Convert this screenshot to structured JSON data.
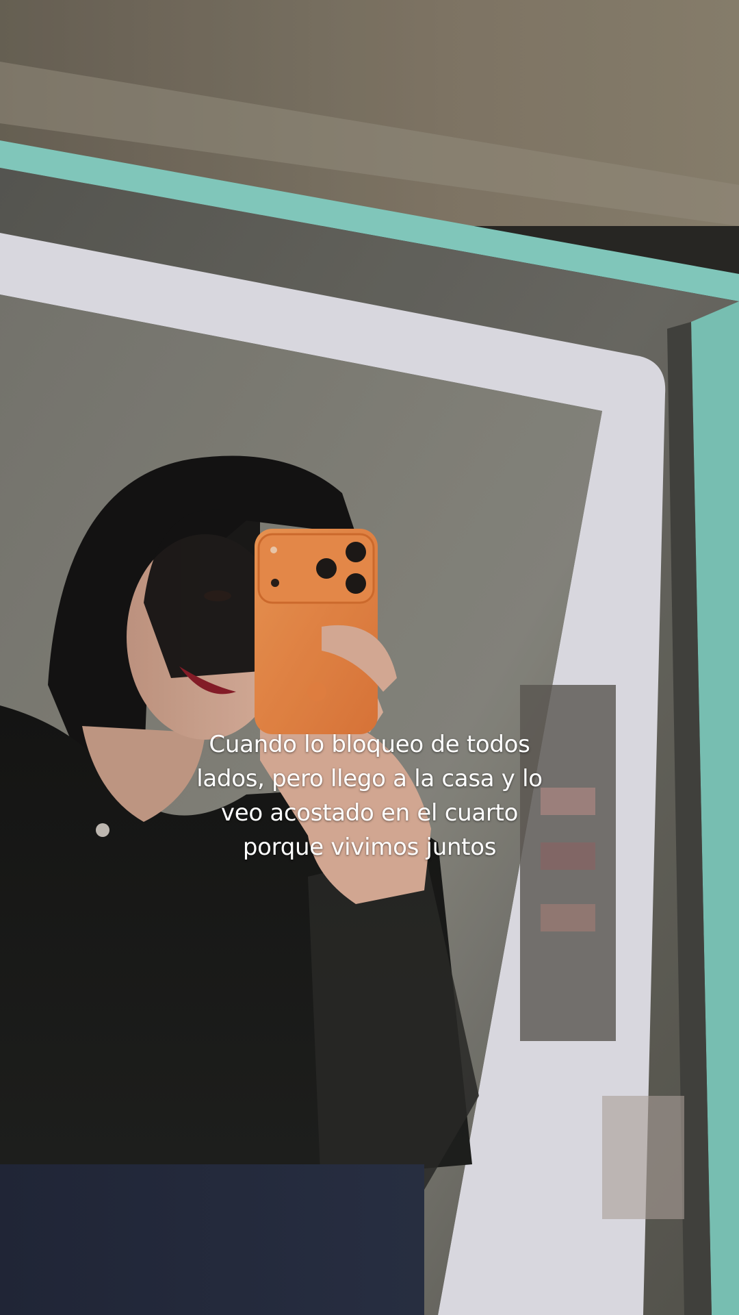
{
  "overlay": {
    "caption": "Cuando lo bloqueo de todos lados, pero llego a la casa y lo veo acostado en el cuarto porque vivimos juntos",
    "caption_color": "#ffffff"
  },
  "photo": {
    "description_icon": "mirror-selfie-photo",
    "accent_colors": {
      "phone_case": "#f08a45",
      "mirror_light": "#e4e3ea",
      "mirror_edge": "#7ec9bd",
      "wall": "#8a8378"
    }
  }
}
